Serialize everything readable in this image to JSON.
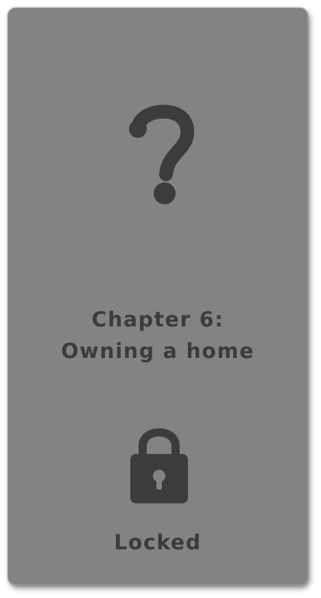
{
  "chapter": {
    "line1": "Chapter 6:",
    "line2": "Owning a home"
  },
  "status": {
    "label": "Locked"
  },
  "icons": {
    "top": "question-mark-icon",
    "bottom": "padlock-icon"
  },
  "colors": {
    "card_background": "#838383",
    "foreground": "#3c3c3c"
  }
}
